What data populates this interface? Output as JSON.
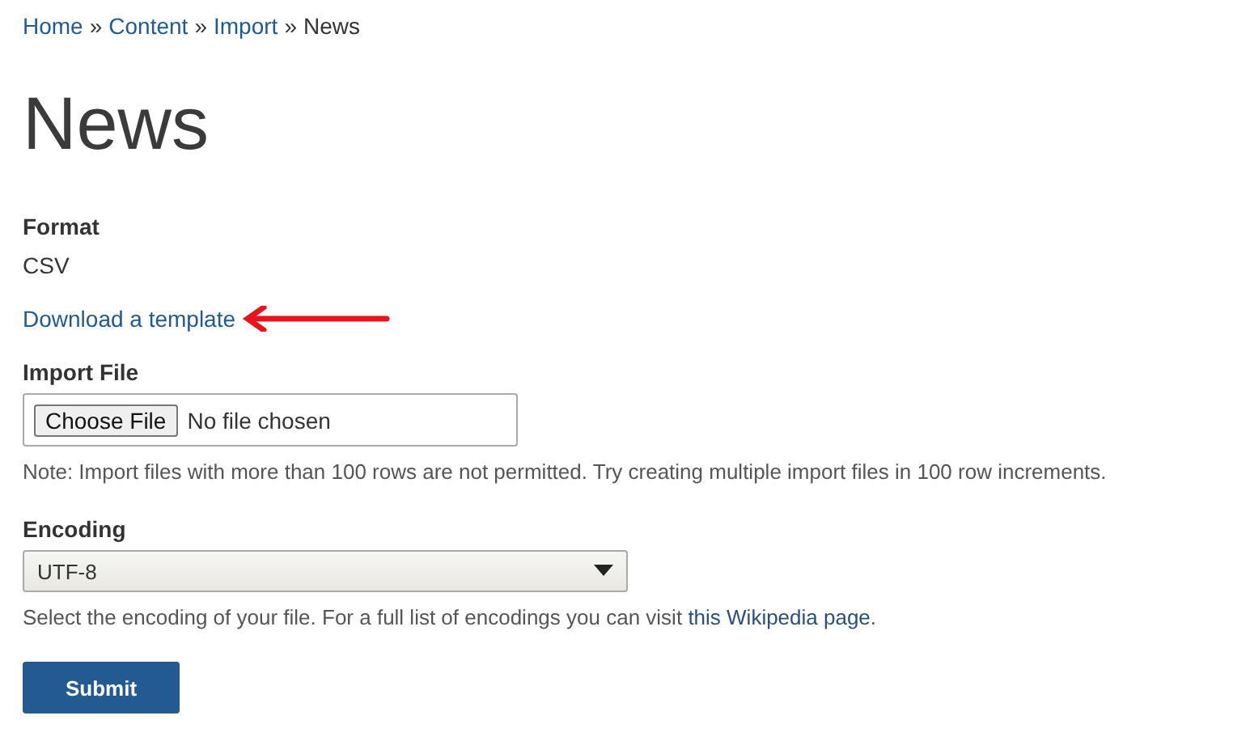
{
  "breadcrumb": [
    {
      "label": "Home",
      "kind": "link"
    },
    {
      "label": "»",
      "kind": "separator"
    },
    {
      "label": "Content",
      "kind": "link"
    },
    {
      "label": "»",
      "kind": "separator"
    },
    {
      "label": "Import",
      "kind": "link"
    },
    {
      "label": "»",
      "kind": "separator"
    },
    {
      "label": "News",
      "kind": "current"
    }
  ],
  "title": "News",
  "format": {
    "label": "Format",
    "value": "CSV"
  },
  "template_link": "Download a template",
  "import_file": {
    "label": "Import File",
    "button": "Choose File",
    "status": "No file chosen",
    "note": "Note: Import files with more than 100 rows are not permitted. Try creating multiple import files in 100 row increments."
  },
  "encoding": {
    "label": "Encoding",
    "value": "UTF-8",
    "description_before": "Select the encoding of your file. For a full list of encodings you can visit",
    "description_link": "this Wikipedia page",
    "description_after": "."
  },
  "submit": "Submit"
}
